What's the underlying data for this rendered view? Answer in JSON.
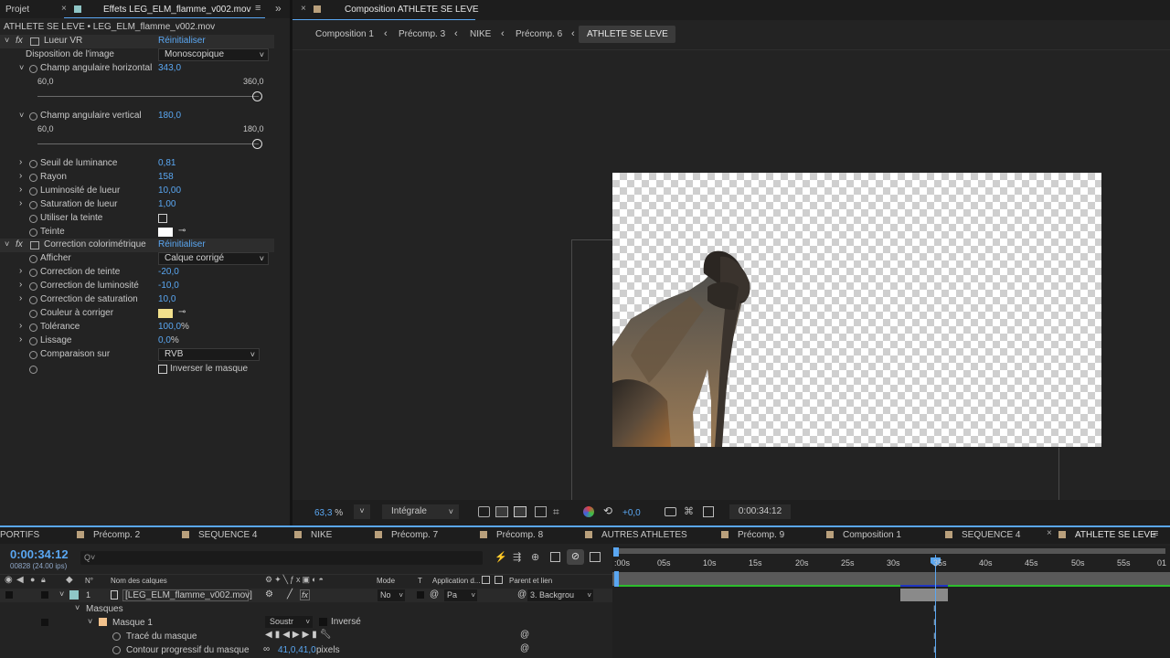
{
  "panels": {
    "projet_tab": "Projet",
    "effets_tab": "Effets LEG_ELM_flamme_v002.mov",
    "comp_prefix": "Composition",
    "comp_name": "ATHLETE SE LEVE"
  },
  "effects": {
    "path": "ATHLETE SE LEVE • LEG_ELM_flamme_v002.mov",
    "fx_symbol": "fx",
    "reset_label": "Réinitialiser",
    "lueur": {
      "name": "Lueur VR",
      "disposition_label": "Disposition de l'image",
      "disposition_value": "Monoscopique",
      "h_label": "Champ angulaire horizontal",
      "h_value": "343,0",
      "h_min": "60,0",
      "h_max": "360,0",
      "h_fraction": 1.0,
      "v_label": "Champ angulaire vertical",
      "v_value": "180,0",
      "v_min": "60,0",
      "v_max": "180,0",
      "v_fraction": 1.0,
      "seuil_label": "Seuil de luminance",
      "seuil_value": "0,81",
      "rayon_label": "Rayon",
      "rayon_value": "158",
      "lum_label": "Luminosité de lueur",
      "lum_value": "10,00",
      "sat_label": "Saturation de lueur",
      "sat_value": "1,00",
      "teinte_use_label": "Utiliser la teinte",
      "teinte_label": "Teinte",
      "teinte_color": "#ffffff"
    },
    "correction": {
      "name": "Correction colorimétrique",
      "afficher_label": "Afficher",
      "afficher_value": "Calque corrigé",
      "teinte_label": "Correction de teinte",
      "teinte_value": "-20,0",
      "lum_label": "Correction de luminosité",
      "lum_value": "-10,0",
      "sat_label": "Correction de saturation",
      "sat_value": "10,0",
      "couleur_label": "Couleur à corriger",
      "couleur_color": "#f2e08c",
      "tol_label": "Tolérance",
      "tol_value": "100,0",
      "lissage_label": "Lissage",
      "lissage_value": "0,0",
      "pct": "%",
      "comp_label": "Comparaison sur",
      "comp_value": "RVB",
      "inverser_label": "Inverser le masque"
    }
  },
  "comp": {
    "breadcrumbs": [
      "Composition 1",
      "Précomp. 3",
      "NIKE",
      "Précomp. 6",
      "ATHLETE SE LEVE"
    ],
    "zoom": "63,3",
    "zoom_unit": "%",
    "resolution": "Intégrale",
    "exposure": "+0,0",
    "timecode": "0:00:34:12"
  },
  "timeline": {
    "tabs": [
      "PORTIFS",
      "Précomp. 2",
      "SEQUENCE 4",
      "NIKE",
      "Précomp. 7",
      "Précomp. 8",
      "AUTRES ATHLETES",
      "Précomp. 9",
      "Composition 1",
      "SEQUENCE 4",
      "ATHLETE SE LEVE"
    ],
    "tab_colors": [
      "#b9a07c",
      "#b9a07c",
      "#b9a07c",
      "#b9a07c",
      "#b9a07c",
      "#b9a07c",
      "#b9a07c",
      "#b9a07c",
      "#b9a07c",
      "#b9a07c",
      "#b9a07c"
    ],
    "timecode": "0:00:34:12",
    "frames": "00828 (24.00 ips)",
    "search_placeholder": "Q˅",
    "cols": {
      "num": "N°",
      "name": "Nom des calques",
      "mode": "Mode",
      "t": "T",
      "app": "Application d...",
      "parent": "Parent et lien"
    },
    "layer": {
      "num": "1",
      "name": "[LEG_ELM_flamme_v002.mov]",
      "mode": "No",
      "app": "Pa",
      "parent": "3. Backgrou",
      "color": "#8fc6c6"
    },
    "masques": "Masques",
    "masque1": "Masque 1",
    "soustr": "Soustr",
    "inverse": "Inversé",
    "trace": "Tracé du masque",
    "contour": "Contour progressif du masque",
    "contour_value": "41,0,41,0",
    "contour_unit": "pixels",
    "ruler": [
      ":00s",
      "05s",
      "10s",
      "15s",
      "20s",
      "25s",
      "30s",
      "35s",
      "40s",
      "45s",
      "50s",
      "55s",
      "01"
    ],
    "playhead_seconds": 34.5
  }
}
